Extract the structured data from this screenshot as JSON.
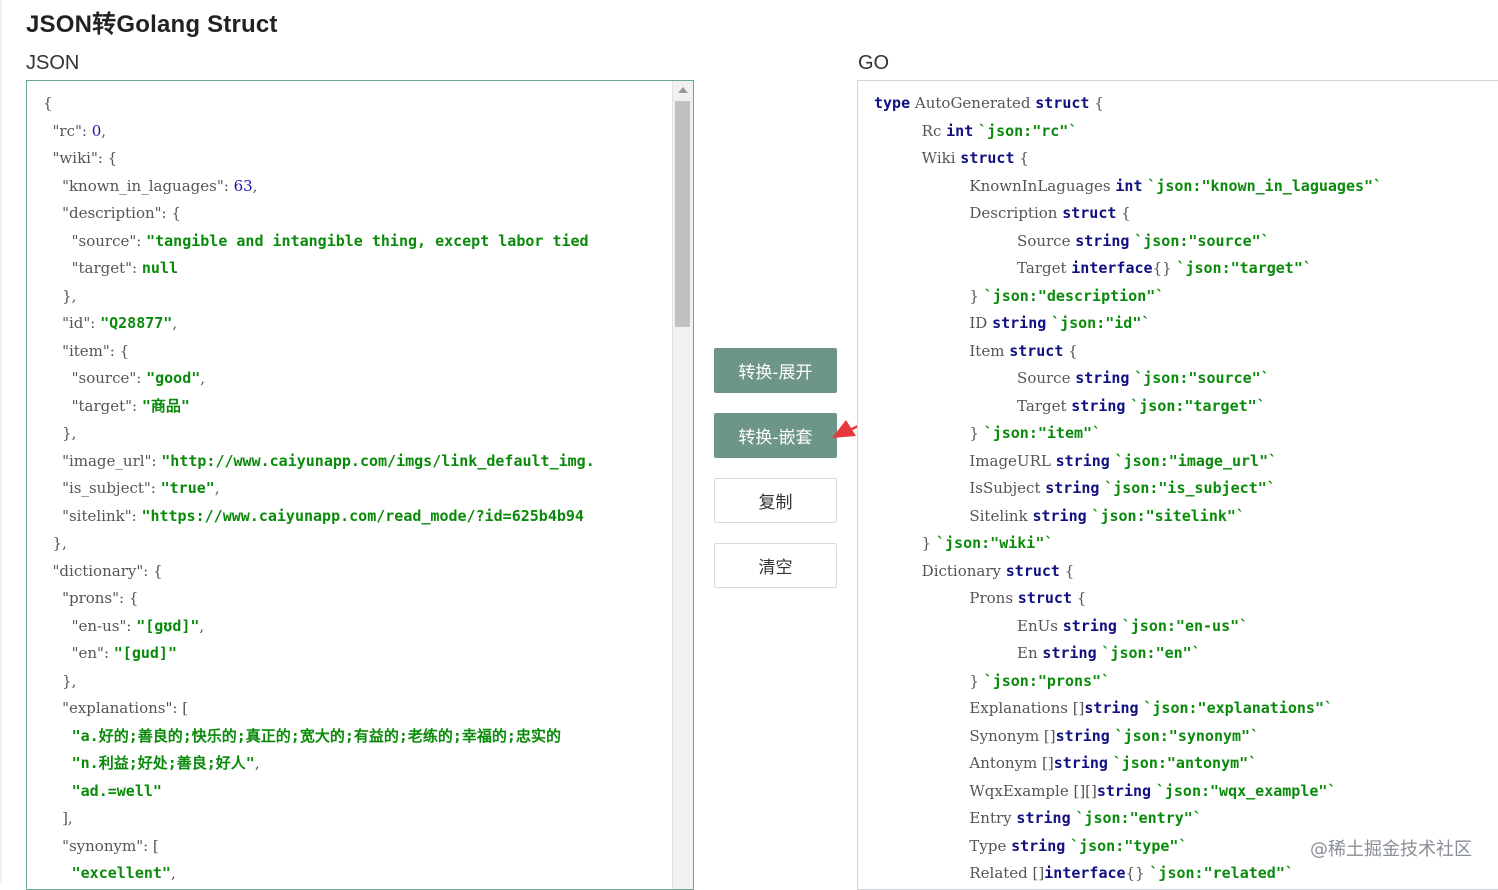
{
  "page": {
    "title": "JSON转Golang Struct",
    "json_label": "JSON",
    "go_label": "GO",
    "watermark": "@稀土掘金技术社区"
  },
  "buttons": {
    "convert_expand": "转换-展开",
    "convert_nested": "转换-嵌套",
    "copy": "复制",
    "clear": "清空"
  },
  "colors": {
    "primary_button": "#6e958a",
    "string_value": "#0a8a0a",
    "keyword": "#101080",
    "arrow": "#e8383d"
  },
  "json_lines": [
    [
      {
        "t": "{"
      }
    ],
    [
      {
        "t": "  \"rc\": "
      },
      {
        "t": "0",
        "c": "n"
      },
      {
        "t": ","
      }
    ],
    [
      {
        "t": "  \"wiki\": {"
      }
    ],
    [
      {
        "t": "    \"known_in_laguages\": "
      },
      {
        "t": "63",
        "c": "n"
      },
      {
        "t": ","
      }
    ],
    [
      {
        "t": "    \"description\": {"
      }
    ],
    [
      {
        "t": "      \"source\": "
      },
      {
        "t": "\"tangible and intangible thing, except labor tied",
        "c": "s"
      }
    ],
    [
      {
        "t": "      \"target\": "
      },
      {
        "t": "null",
        "c": "s"
      }
    ],
    [
      {
        "t": "    },"
      }
    ],
    [
      {
        "t": "    \"id\": "
      },
      {
        "t": "\"Q28877\"",
        "c": "s"
      },
      {
        "t": ","
      }
    ],
    [
      {
        "t": "    \"item\": {"
      }
    ],
    [
      {
        "t": "      \"source\": "
      },
      {
        "t": "\"good\"",
        "c": "s"
      },
      {
        "t": ","
      }
    ],
    [
      {
        "t": "      \"target\": "
      },
      {
        "t": "\"商品\"",
        "c": "s"
      }
    ],
    [
      {
        "t": "    },"
      }
    ],
    [
      {
        "t": "    \"image_url\": "
      },
      {
        "t": "\"http://www.caiyunapp.com/imgs/link_default_img.",
        "c": "s"
      }
    ],
    [
      {
        "t": "    \"is_subject\": "
      },
      {
        "t": "\"true\"",
        "c": "s"
      },
      {
        "t": ","
      }
    ],
    [
      {
        "t": "    \"sitelink\": "
      },
      {
        "t": "\"https://www.caiyunapp.com/read_mode/?id=625b4b94",
        "c": "s"
      }
    ],
    [
      {
        "t": "  },"
      }
    ],
    [
      {
        "t": "  \"dictionary\": {"
      }
    ],
    [
      {
        "t": "    \"prons\": {"
      }
    ],
    [
      {
        "t": "      \"en-us\": "
      },
      {
        "t": "\"[gʊd]\"",
        "c": "s"
      },
      {
        "t": ","
      }
    ],
    [
      {
        "t": "      \"en\": "
      },
      {
        "t": "\"[gud]\"",
        "c": "s"
      }
    ],
    [
      {
        "t": "    },"
      }
    ],
    [
      {
        "t": "    \"explanations\": ["
      }
    ],
    [
      {
        "t": "      "
      },
      {
        "t": "\"a.好的;善良的;快乐的;真正的;宽大的;有益的;老练的;幸福的;忠实的",
        "c": "s"
      }
    ],
    [
      {
        "t": "      "
      },
      {
        "t": "\"n.利益;好处;善良;好人\"",
        "c": "s"
      },
      {
        "t": ","
      }
    ],
    [
      {
        "t": "      "
      },
      {
        "t": "\"ad.=well\"",
        "c": "s"
      }
    ],
    [
      {
        "t": "    ],"
      }
    ],
    [
      {
        "t": "    \"synonym\": ["
      }
    ],
    [
      {
        "t": "      "
      },
      {
        "t": "\"excellent\"",
        "c": "s"
      },
      {
        "t": ","
      }
    ]
  ],
  "go_lines": [
    [
      {
        "t": "type",
        "c": "kw"
      },
      {
        "t": " AutoGenerated "
      },
      {
        "t": "struct",
        "c": "kw"
      },
      {
        "t": " {"
      }
    ],
    [
      {
        "t": "          Rc "
      },
      {
        "t": "int",
        "c": "kw"
      },
      {
        "t": " "
      },
      {
        "t": "`json:\"rc\"`",
        "c": "s"
      }
    ],
    [
      {
        "t": "          Wiki "
      },
      {
        "t": "struct",
        "c": "kw"
      },
      {
        "t": " {"
      }
    ],
    [
      {
        "t": "                    KnownInLaguages "
      },
      {
        "t": "int",
        "c": "kw"
      },
      {
        "t": " "
      },
      {
        "t": "`json:\"known_in_laguages\"`",
        "c": "s"
      }
    ],
    [
      {
        "t": "                    Description "
      },
      {
        "t": "struct",
        "c": "kw"
      },
      {
        "t": " {"
      }
    ],
    [
      {
        "t": "                              Source "
      },
      {
        "t": "string",
        "c": "kw"
      },
      {
        "t": " "
      },
      {
        "t": "`json:\"source\"`",
        "c": "s"
      }
    ],
    [
      {
        "t": "                              Target "
      },
      {
        "t": "interface",
        "c": "kw"
      },
      {
        "t": "{} "
      },
      {
        "t": "`json:\"target\"`",
        "c": "s"
      }
    ],
    [
      {
        "t": "                    } "
      },
      {
        "t": "`json:\"description\"`",
        "c": "s"
      }
    ],
    [
      {
        "t": "                    ID "
      },
      {
        "t": "string",
        "c": "kw"
      },
      {
        "t": " "
      },
      {
        "t": "`json:\"id\"`",
        "c": "s"
      }
    ],
    [
      {
        "t": "                    Item "
      },
      {
        "t": "struct",
        "c": "kw"
      },
      {
        "t": " {"
      }
    ],
    [
      {
        "t": "                              Source "
      },
      {
        "t": "string",
        "c": "kw"
      },
      {
        "t": " "
      },
      {
        "t": "`json:\"source\"`",
        "c": "s"
      }
    ],
    [
      {
        "t": "                              Target "
      },
      {
        "t": "string",
        "c": "kw"
      },
      {
        "t": " "
      },
      {
        "t": "`json:\"target\"`",
        "c": "s"
      }
    ],
    [
      {
        "t": "                    } "
      },
      {
        "t": "`json:\"item\"`",
        "c": "s"
      }
    ],
    [
      {
        "t": "                    ImageURL "
      },
      {
        "t": "string",
        "c": "kw"
      },
      {
        "t": " "
      },
      {
        "t": "`json:\"image_url\"`",
        "c": "s"
      }
    ],
    [
      {
        "t": "                    IsSubject "
      },
      {
        "t": "string",
        "c": "kw"
      },
      {
        "t": " "
      },
      {
        "t": "`json:\"is_subject\"`",
        "c": "s"
      }
    ],
    [
      {
        "t": "                    Sitelink "
      },
      {
        "t": "string",
        "c": "kw"
      },
      {
        "t": " "
      },
      {
        "t": "`json:\"sitelink\"`",
        "c": "s"
      }
    ],
    [
      {
        "t": "          } "
      },
      {
        "t": "`json:\"wiki\"`",
        "c": "s"
      }
    ],
    [
      {
        "t": "          Dictionary "
      },
      {
        "t": "struct",
        "c": "kw"
      },
      {
        "t": " {"
      }
    ],
    [
      {
        "t": "                    Prons "
      },
      {
        "t": "struct",
        "c": "kw"
      },
      {
        "t": " {"
      }
    ],
    [
      {
        "t": "                              EnUs "
      },
      {
        "t": "string",
        "c": "kw"
      },
      {
        "t": " "
      },
      {
        "t": "`json:\"en-us\"`",
        "c": "s"
      }
    ],
    [
      {
        "t": "                              En "
      },
      {
        "t": "string",
        "c": "kw"
      },
      {
        "t": " "
      },
      {
        "t": "`json:\"en\"`",
        "c": "s"
      }
    ],
    [
      {
        "t": "                    } "
      },
      {
        "t": "`json:\"prons\"`",
        "c": "s"
      }
    ],
    [
      {
        "t": "                    Explanations []"
      },
      {
        "t": "string",
        "c": "kw"
      },
      {
        "t": " "
      },
      {
        "t": "`json:\"explanations\"`",
        "c": "s"
      }
    ],
    [
      {
        "t": "                    Synonym []"
      },
      {
        "t": "string",
        "c": "kw"
      },
      {
        "t": " "
      },
      {
        "t": "`json:\"synonym\"`",
        "c": "s"
      }
    ],
    [
      {
        "t": "                    Antonym []"
      },
      {
        "t": "string",
        "c": "kw"
      },
      {
        "t": " "
      },
      {
        "t": "`json:\"antonym\"`",
        "c": "s"
      }
    ],
    [
      {
        "t": "                    WqxExample [][]"
      },
      {
        "t": "string",
        "c": "kw"
      },
      {
        "t": " "
      },
      {
        "t": "`json:\"wqx_example\"`",
        "c": "s"
      }
    ],
    [
      {
        "t": "                    Entry "
      },
      {
        "t": "string",
        "c": "kw"
      },
      {
        "t": " "
      },
      {
        "t": "`json:\"entry\"`",
        "c": "s"
      }
    ],
    [
      {
        "t": "                    Type "
      },
      {
        "t": "string",
        "c": "kw"
      },
      {
        "t": " "
      },
      {
        "t": "`json:\"type\"`",
        "c": "s"
      }
    ],
    [
      {
        "t": "                    Related []"
      },
      {
        "t": "interface",
        "c": "kw"
      },
      {
        "t": "{} "
      },
      {
        "t": "`json:\"related\"`",
        "c": "s"
      }
    ]
  ]
}
